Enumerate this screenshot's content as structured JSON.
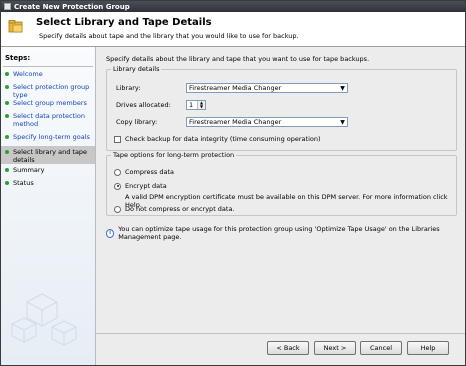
{
  "window": {
    "title": "Create New Protection Group",
    "icon": "app-icon"
  },
  "header": {
    "title": "Select Library and Tape Details",
    "subtitle": "Specify details about tape and the library that you would like to use for backup.",
    "icon": "library-folder-icon"
  },
  "steps": {
    "heading": "Steps:",
    "items": [
      {
        "label": "Welcome",
        "state": "done"
      },
      {
        "label": "Select protection group type",
        "state": "done"
      },
      {
        "label": "Select group members",
        "state": "done"
      },
      {
        "label": "Select data protection method",
        "state": "done"
      },
      {
        "label": "Specify long-term goals",
        "state": "done"
      },
      {
        "label": "Select library and tape details",
        "state": "current"
      },
      {
        "label": "Summary",
        "state": "pending"
      },
      {
        "label": "Status",
        "state": "pending"
      }
    ]
  },
  "main": {
    "intro": "Specify details about the library and tape that you want to use for tape backups.",
    "library_details": {
      "legend": "Library details",
      "library_label": "Library:",
      "library_value": "Firestreamer Media Changer",
      "drives_label": "Drives allocated:",
      "drives_value": "1",
      "copy_library_label": "Copy library:",
      "copy_library_value": "Firestreamer Media Changer",
      "integrity_label": "Check backup for data integrity (time consuming operation)"
    },
    "tape_options": {
      "legend": "Tape options for long-term protection",
      "compress_label": "Compress data",
      "encrypt_label": "Encrypt data",
      "encrypt_note": "A valid DPM encryption certificate must be available on this DPM server. For more information click Help.",
      "none_label": "Do not compress or encrypt data.",
      "selected": "encrypt"
    },
    "info_text": "You can optimize tape usage for this protection group using 'Optimize Tape Usage' on the Libraries Management page."
  },
  "buttons": {
    "back": "< Back",
    "next": "Next >",
    "cancel": "Cancel",
    "help": "Help"
  },
  "colors": {
    "title_bar": "#2d3138",
    "link": "#1443b8",
    "step_dot": "#2e9f35",
    "current_step_bg": "#c7c7c7"
  }
}
